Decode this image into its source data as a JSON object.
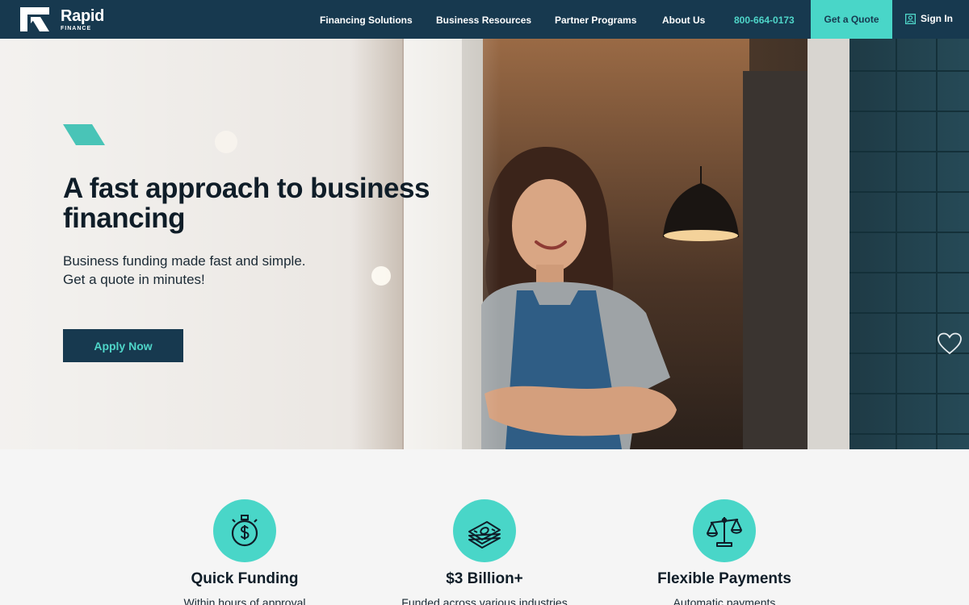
{
  "brand": {
    "name": "Rapid",
    "sub": "FINANCE"
  },
  "nav": {
    "items": [
      {
        "label": "Financing Solutions"
      },
      {
        "label": "Business Resources"
      },
      {
        "label": "Partner Programs"
      },
      {
        "label": "About Us"
      }
    ],
    "phone": "800-664-0173",
    "quote_label": "Get a Quote",
    "signin_label": "Sign In"
  },
  "hero": {
    "title": "A fast approach to business financing",
    "subtitle_line1": "Business funding made fast and simple.",
    "subtitle_line2": "Get a quote in minutes!",
    "cta_label": "Apply Now"
  },
  "features": [
    {
      "icon": "stopwatch-dollar-icon",
      "title": "Quick Funding",
      "desc": "Within hours of approval"
    },
    {
      "icon": "money-stack-icon",
      "title": "$3 Billion+",
      "desc": "Funded across various industries"
    },
    {
      "icon": "scales-icon",
      "title": "Flexible Payments",
      "desc": "Automatic payments"
    }
  ],
  "colors": {
    "navy": "#17394f",
    "teal": "#49d6c8"
  }
}
